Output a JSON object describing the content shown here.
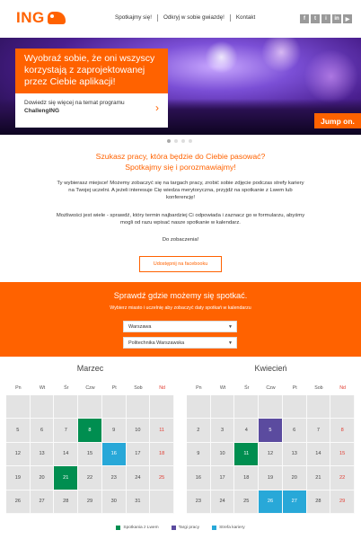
{
  "brand": {
    "name": "ING",
    "accent": "#ff6200"
  },
  "nav": [
    "Spotkajmy się!",
    "Odkryj w sobie gwiazdę!",
    "Kontakt"
  ],
  "socials": [
    "f",
    "t",
    "i",
    "in",
    "▶"
  ],
  "hero": {
    "headline": "Wyobraź sobie, że oni wszyscy korzystają z zaprojektowanej przez Ciebie aplikacji!",
    "link_text": "Dowiedz się więcej na temat programu",
    "link_bold": "ChallengING",
    "badge": "Jump on."
  },
  "intro": {
    "title_line1": "Szukasz pracy, która będzie do Ciebie pasować?",
    "title_line2": "Spotkajmy się i porozmawiajmy!",
    "p1": "Ty wybierasz miejsce! Możemy zobaczyć się na targach pracy, zrobić sobie zdjęcie podczas strefy kariery na Twojej uczelni. A jeżeli interesuje Cię wiedza merytoryczna, przyjdź na spotkanie z Lwem lub konferencję!",
    "p2": "Możliwości jest wiele - sprawdź, który termin najbardziej Ci odpowiada i zaznacz go w formularzu, abyśmy mogli od razu wpisać nasze spotkanie w kalendarz.",
    "p3": "Do zobaczenia!",
    "fb_button": "Udostępnij na facebooku"
  },
  "band": {
    "title": "Sprawdź gdzie możemy się spotkać.",
    "subtitle": "Wybierz miasto i uczelnię aby zobaczyć daty spotkań w kalendarzu",
    "city": "Warszawa",
    "school": "Politechnika Warszawska"
  },
  "weekdays": [
    "Pn",
    "Wt",
    "Śr",
    "Czw",
    "Pt",
    "Sob",
    "Nd"
  ],
  "calendars": [
    {
      "month": "Marzec",
      "weeks": [
        [
          "",
          "",
          "",
          "",
          "",
          "",
          ""
        ],
        [
          "5",
          "6",
          "7",
          "8",
          "9",
          "10",
          "11"
        ],
        [
          "12",
          "13",
          "14",
          "15",
          "16",
          "17",
          "18"
        ],
        [
          "19",
          "20",
          "21",
          "22",
          "23",
          "24",
          "25"
        ],
        [
          "26",
          "27",
          "28",
          "29",
          "30",
          "31",
          ""
        ]
      ],
      "events": {
        "8": "green",
        "16": "blue",
        "21": "green"
      }
    },
    {
      "month": "Kwiecień",
      "weeks": [
        [
          "",
          "",
          "",
          "",
          "",
          "",
          ""
        ],
        [
          "2",
          "3",
          "4",
          "5",
          "6",
          "7",
          "8"
        ],
        [
          "9",
          "10",
          "11",
          "12",
          "13",
          "14",
          "15"
        ],
        [
          "16",
          "17",
          "18",
          "19",
          "20",
          "21",
          "22"
        ],
        [
          "23",
          "24",
          "25",
          "26",
          "27",
          "28",
          "29"
        ]
      ],
      "events": {
        "5": "purple",
        "11": "green",
        "26": "blue",
        "27": "blue"
      }
    }
  ],
  "legend": [
    {
      "label": "Spotkania z Lwem",
      "color": "#008e50"
    },
    {
      "label": "Targi pracy",
      "color": "#5b4b9f"
    },
    {
      "label": "Strefa kariery",
      "color": "#28a8d8"
    }
  ]
}
